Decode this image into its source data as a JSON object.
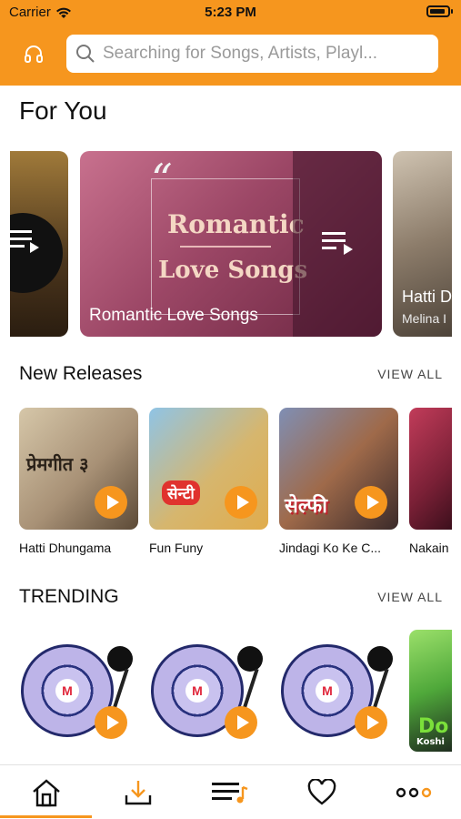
{
  "status_bar": {
    "carrier": "Carrier",
    "time": "5:23 PM"
  },
  "search": {
    "placeholder": "Searching for Songs, Artists, Playl..."
  },
  "for_you": {
    "title": "For You",
    "cards": [
      {
        "label": "Romantic Love Songs",
        "art_line1": "Romantic",
        "art_line2": "Love Songs",
        "quote": "“"
      },
      {
        "title": "Hatti D",
        "subtitle": "Melina I"
      }
    ]
  },
  "new_releases": {
    "title": "New Releases",
    "view_all": "VIEW ALL",
    "items": [
      {
        "label": "Hatti Dhungama",
        "art_text": "प्रेमगीत ३"
      },
      {
        "label": "Fun Funy",
        "art_text": "सेन्टी"
      },
      {
        "label": "Jindagi Ko Ke C...",
        "art_text": "सेल्फी"
      },
      {
        "label": "Nakain"
      }
    ]
  },
  "trending": {
    "title": "TRENDING",
    "view_all": "VIEW ALL",
    "vinyl_logo": "M",
    "partial_tile_text": "Do",
    "partial_tile_sub": "Koshi"
  },
  "colors": {
    "accent": "#f6961e",
    "background": "#ffffff"
  },
  "tabs": [
    {
      "icon": "home-icon",
      "active": true
    },
    {
      "icon": "download-icon",
      "active": false
    },
    {
      "icon": "playlist-icon",
      "active": false
    },
    {
      "icon": "heart-icon",
      "active": false
    },
    {
      "icon": "more-icon",
      "active": false
    }
  ]
}
